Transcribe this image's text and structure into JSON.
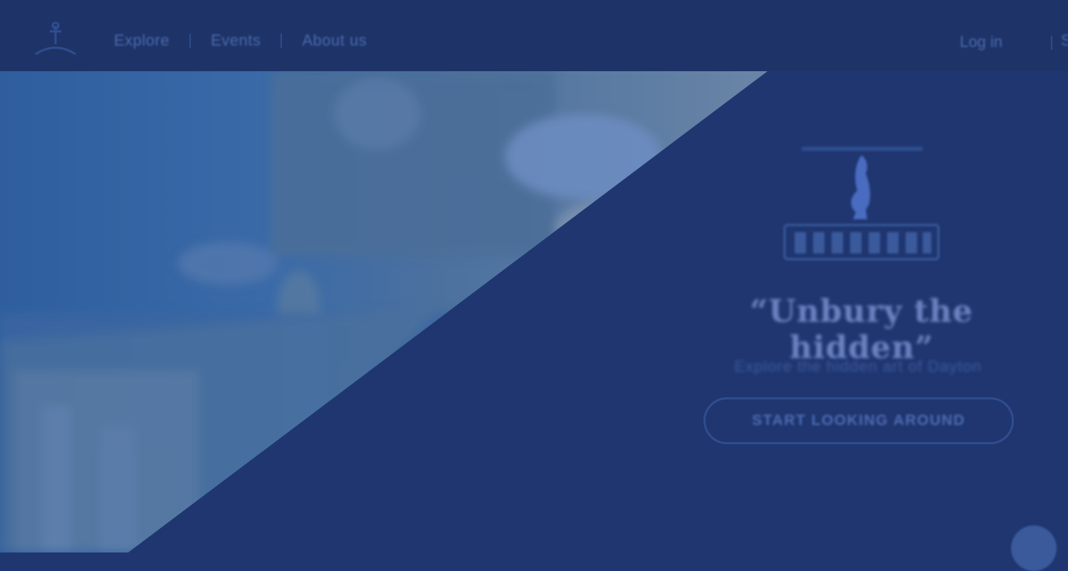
{
  "header": {
    "nav": [
      {
        "label": "Explore"
      },
      {
        "label": "Events"
      },
      {
        "label": "About us"
      }
    ],
    "login_label": "Log in",
    "trailing_label": "S"
  },
  "hero": {
    "tagline": "“Unbury the hidden”",
    "subtitle": "Explore the hidden art of Dayton",
    "cta_label": "START LOOKING AROUND"
  },
  "colors": {
    "background": "#1f3670",
    "header": "#1e3468",
    "overlay_text": "#4a69ad"
  },
  "icons": [
    "site-logo-icon",
    "brand-statue-icon",
    "chat-icon"
  ]
}
